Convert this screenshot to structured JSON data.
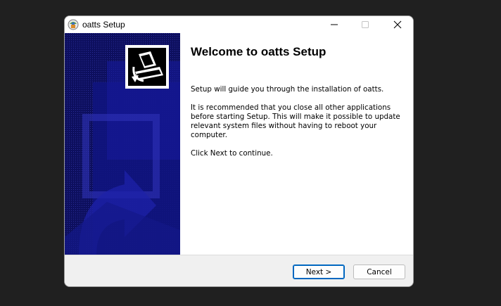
{
  "window": {
    "title": "oatts Setup"
  },
  "content": {
    "heading": "Welcome to oatts Setup",
    "intro": "Setup will guide you through the installation of oatts.",
    "recommendation": "It is recommended that you close all other applications\nbefore starting Setup. This will make it possible to update\nrelevant system files without having to reboot your\ncomputer.",
    "instruction": "Click Next to continue."
  },
  "buttons": {
    "next_label": "Next >",
    "cancel_label": "Cancel"
  },
  "icons": {
    "app": "installer-app-icon",
    "installer_image": "installer-computer-icon",
    "minimize": "minimize-icon",
    "maximize": "maximize-icon",
    "close": "close-icon"
  },
  "colors": {
    "side_panel": "#0f1168",
    "default_button_border": "#0067c0",
    "desktop_background": "#202020"
  }
}
